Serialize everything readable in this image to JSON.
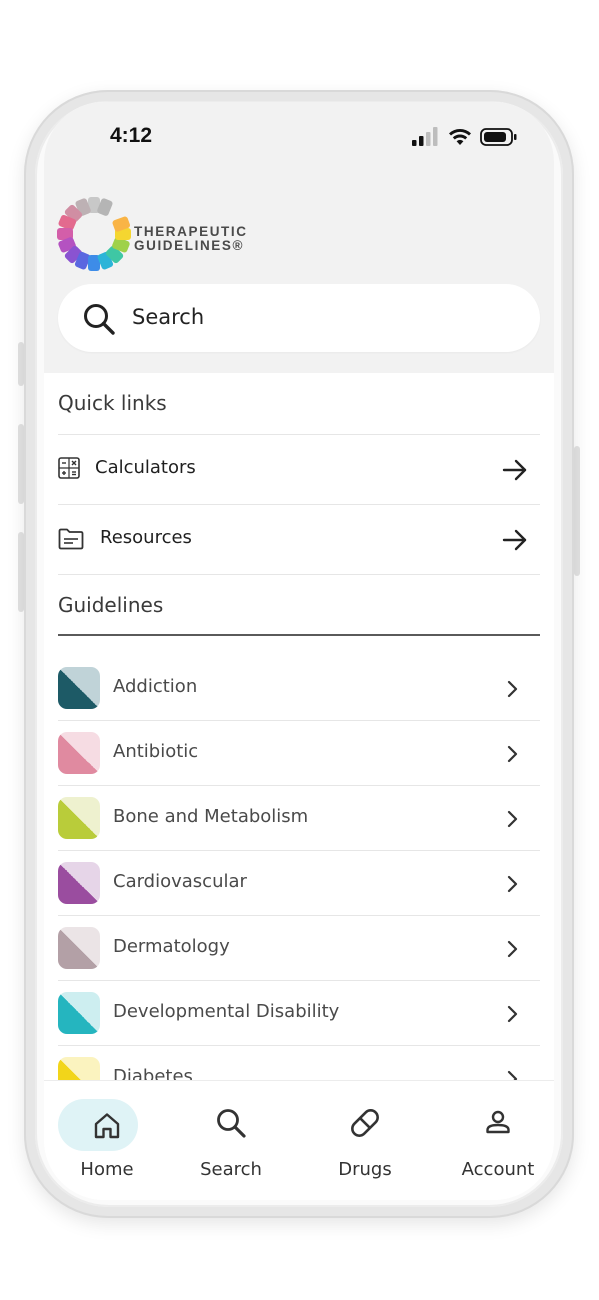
{
  "status_bar": {
    "time": "4:12"
  },
  "app": {
    "logo_text_line1": "THERAPEUTIC",
    "logo_text_line2": "GUIDELINES®"
  },
  "search": {
    "placeholder": "Search"
  },
  "quick_links": {
    "title": "Quick links",
    "items": [
      {
        "label": "Calculators",
        "icon": "calculator-icon"
      },
      {
        "label": "Resources",
        "icon": "folder-icon"
      }
    ]
  },
  "guidelines": {
    "title": "Guidelines",
    "items": [
      {
        "label": "Addiction",
        "color_dark": "#1d5a66",
        "color_light": "#c0d3d8"
      },
      {
        "label": "Antibiotic",
        "color_dark": "#e08aa0",
        "color_light": "#f6dce3"
      },
      {
        "label": "Bone and Metabolism",
        "color_dark": "#b9cc3a",
        "color_light": "#eef1cf"
      },
      {
        "label": "Cardiovascular",
        "color_dark": "#9a4d9f",
        "color_light": "#e6d5e8"
      },
      {
        "label": "Dermatology",
        "color_dark": "#b3a0a6",
        "color_light": "#ebe4e6"
      },
      {
        "label": "Developmental Disability",
        "color_dark": "#25b5bf",
        "color_light": "#cdeef0"
      },
      {
        "label": "Diabetes",
        "color_dark": "#f2d51a",
        "color_light": "#fbf3bf"
      }
    ]
  },
  "bottom_nav": {
    "items": [
      {
        "label": "Home",
        "icon": "home-icon",
        "active": true
      },
      {
        "label": "Search",
        "icon": "search-icon",
        "active": false
      },
      {
        "label": "Drugs",
        "icon": "pill-icon",
        "active": false
      },
      {
        "label": "Account",
        "icon": "person-icon",
        "active": false
      }
    ],
    "active_color": "#dff3f6"
  }
}
